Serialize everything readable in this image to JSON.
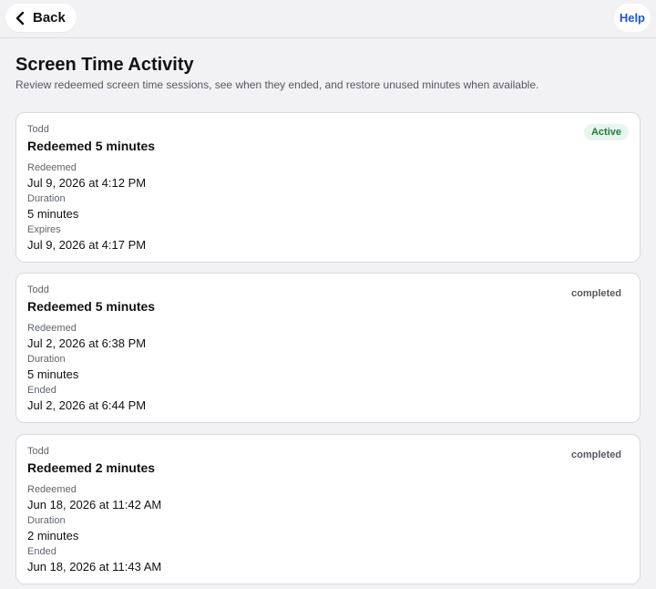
{
  "header": {
    "back_label": "Back",
    "help_label": "Help"
  },
  "page": {
    "title": "Screen Time Activity",
    "subtitle": "Review redeemed screen time sessions, see when they ended, and restore unused minutes when available."
  },
  "colors": {
    "accent": "#1a56d6",
    "active_bg": "#e8f5ec",
    "active_text": "#1f7a3d",
    "completed_text": "#55585e"
  },
  "sessions": [
    {
      "child": "Todd",
      "title": "Redeemed 5 minutes",
      "status": "Active",
      "redeemed_label": "Redeemed",
      "redeemed_value": "Jul 9, 2026 at 4:12 PM",
      "duration_label": "Duration",
      "duration_value": "5 minutes",
      "end_label": "Expires",
      "end_value": "Jul 9, 2026 at 4:17 PM"
    },
    {
      "child": "Todd",
      "title": "Redeemed 5 minutes",
      "status": "completed",
      "redeemed_label": "Redeemed",
      "redeemed_value": "Jul 2, 2026 at 6:38 PM",
      "duration_label": "Duration",
      "duration_value": "5 minutes",
      "end_label": "Ended",
      "end_value": "Jul 2, 2026 at 6:44 PM"
    },
    {
      "child": "Todd",
      "title": "Redeemed 2 minutes",
      "status": "completed",
      "redeemed_label": "Redeemed",
      "redeemed_value": "Jun 18, 2026 at 11:42 AM",
      "duration_label": "Duration",
      "duration_value": "2 minutes",
      "end_label": "Ended",
      "end_value": "Jun 18, 2026 at 11:43 AM"
    }
  ]
}
